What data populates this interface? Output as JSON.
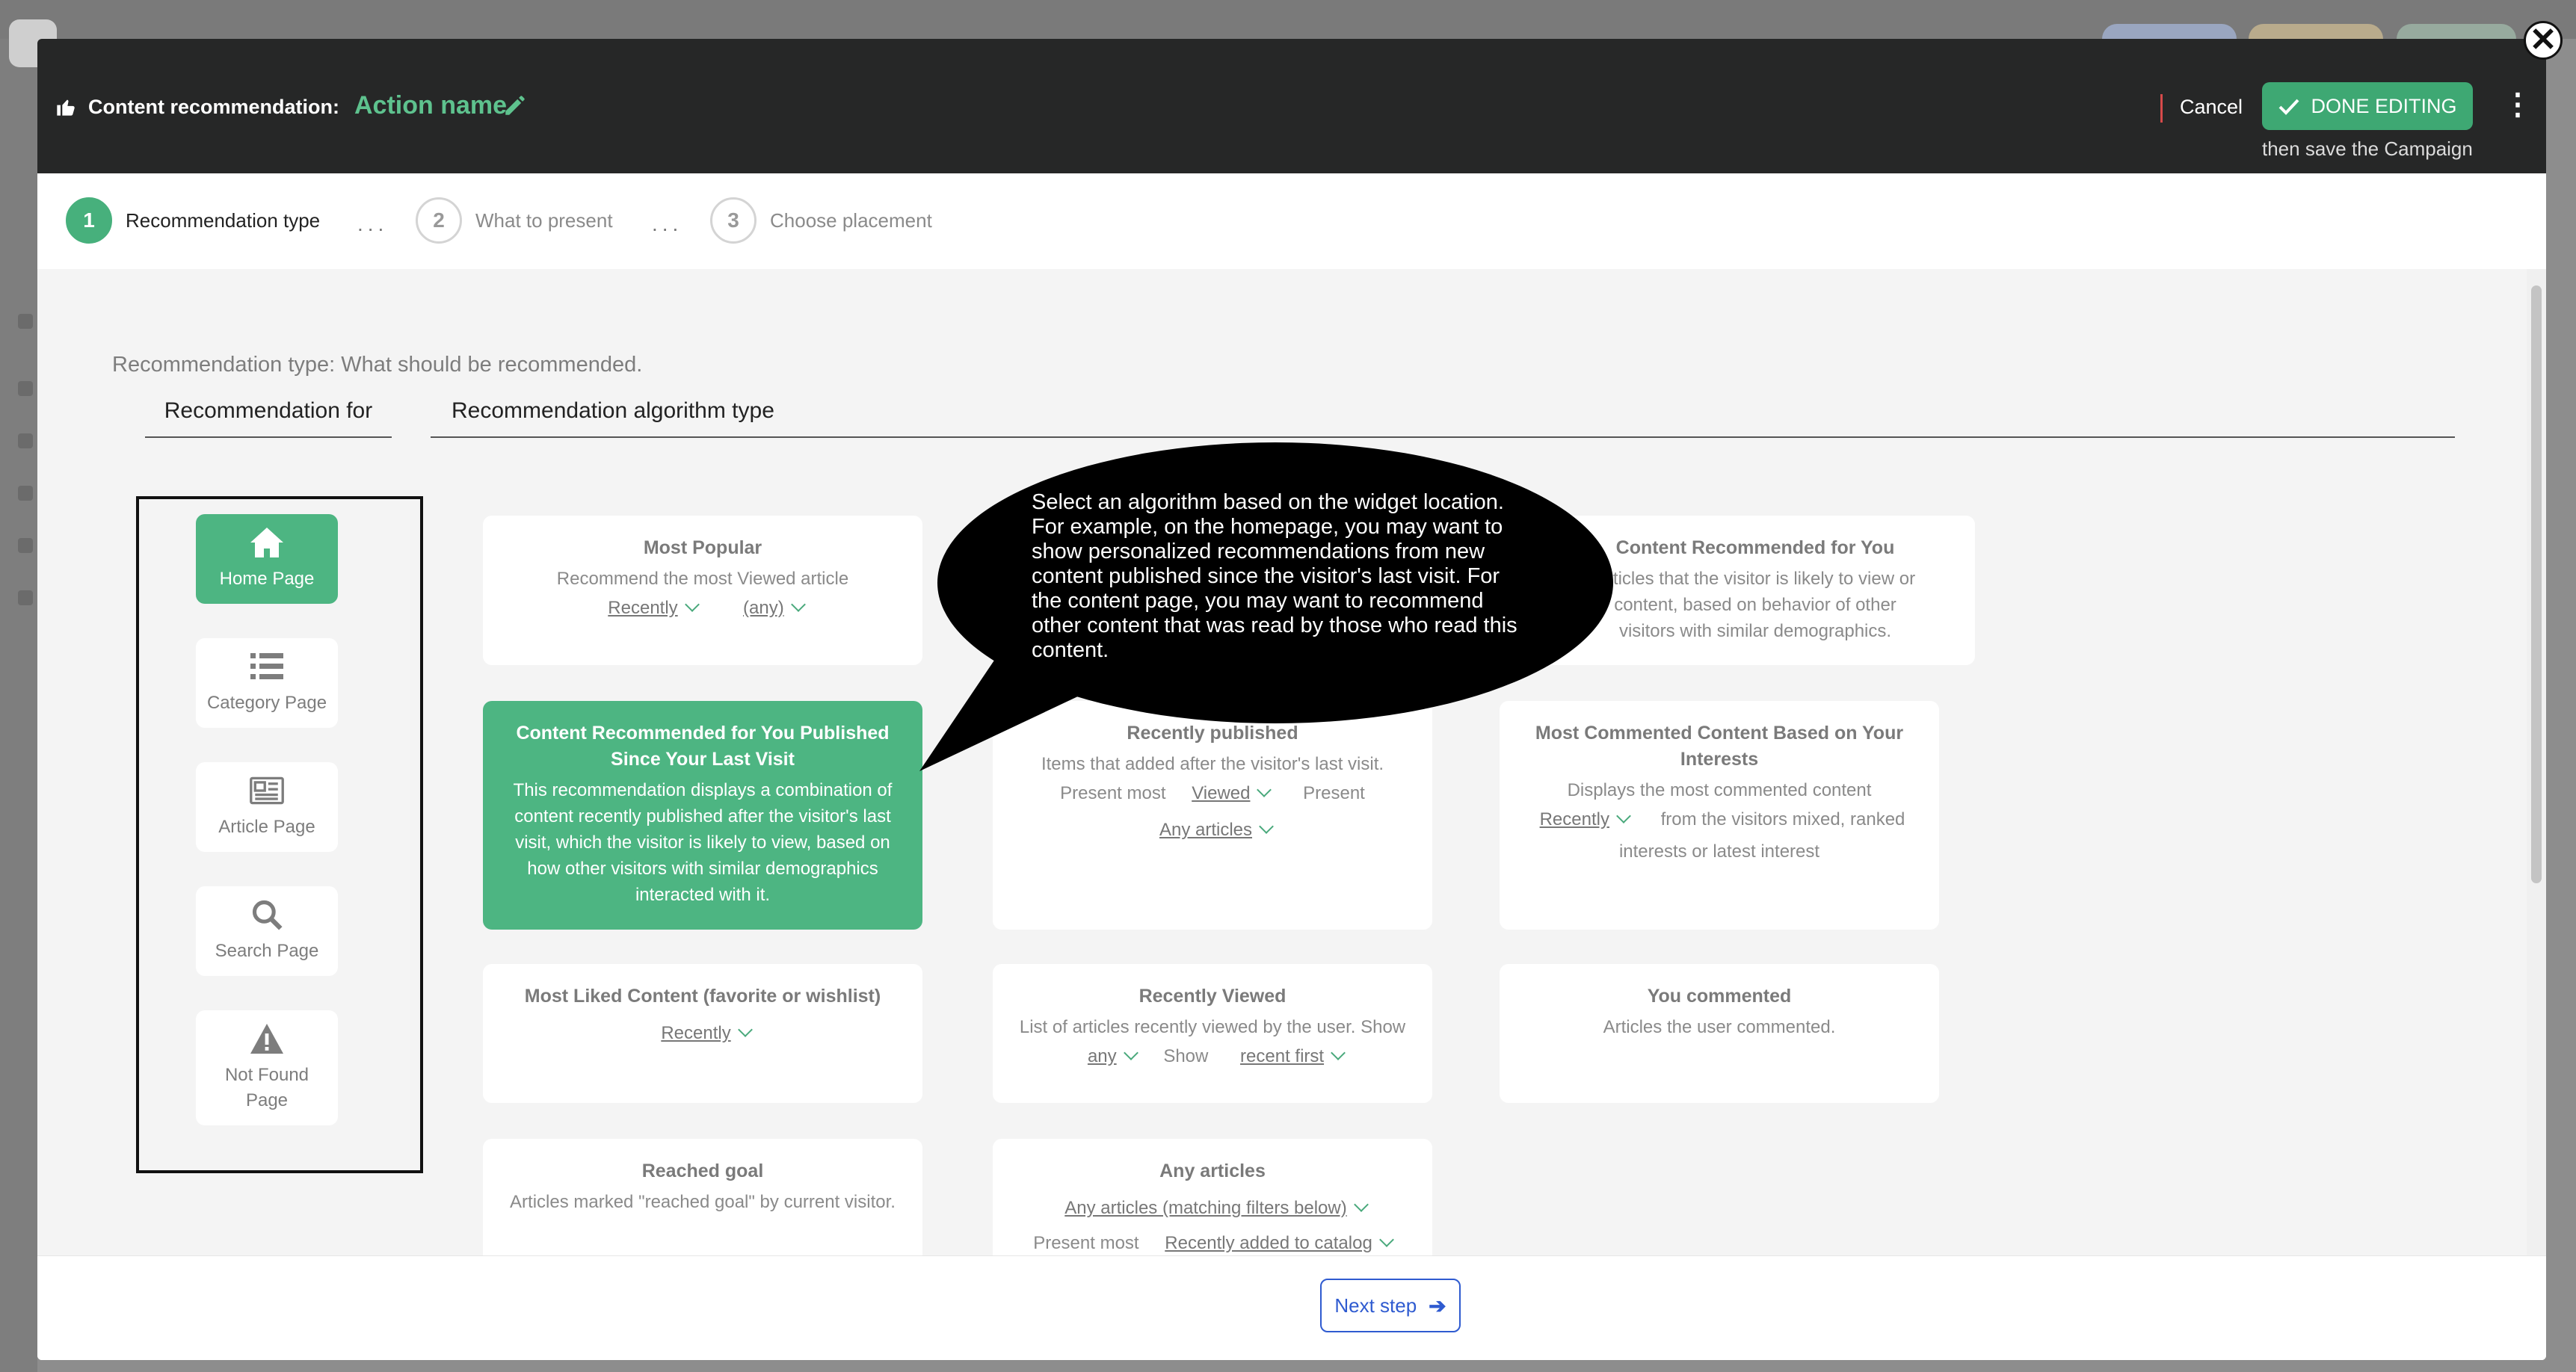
{
  "header": {
    "label": "Content recommendation:",
    "action_name": "Action name",
    "cancel": "Cancel",
    "done": "DONE EDITING",
    "done_sub": "then save the Campaign"
  },
  "close_symbol": "✕",
  "stepper": {
    "steps": [
      {
        "num": "1",
        "label": "Recommendation type"
      },
      {
        "num": "2",
        "label": "What to present"
      },
      {
        "num": "3",
        "label": "Choose placement"
      }
    ],
    "separator": "..."
  },
  "main": {
    "intro": "Recommendation type: What should be recommended.",
    "tab_for": "Recommendation for",
    "tab_algorithm": "Recommendation algorithm type"
  },
  "locations": [
    {
      "label": "Home Page",
      "icon": "home-icon",
      "selected": true
    },
    {
      "label": "Category Page",
      "icon": "list-icon",
      "selected": false
    },
    {
      "label": "Article Page",
      "icon": "newspaper-icon",
      "selected": false
    },
    {
      "label": "Search Page",
      "icon": "search-icon",
      "selected": false
    },
    {
      "label": "Not Found Page",
      "icon": "warning-icon",
      "selected": false
    }
  ],
  "cards": {
    "most_popular": {
      "title": "Most Popular",
      "desc": "Recommend the most Viewed article",
      "opt1": "Recently",
      "opt2": "(any)"
    },
    "content_for_you": {
      "title": "Content Recommended for You",
      "desc": "Articles that the visitor is likely to view or content, based on behavior of other visitors with similar demographics."
    },
    "published_since": {
      "title": "Content Recommended for You Published Since Your Last Visit",
      "desc": "This recommendation displays a combination of content recently published after the visitor's last visit, which the visitor is likely to view, based on how other visitors with similar demographics interacted with it."
    },
    "recently_published": {
      "title": "Recently published",
      "desc": "Items that added after the visitor's last visit.",
      "pre": "Present most",
      "opt1": "Viewed",
      "post": "Present",
      "opt2": "Any articles"
    },
    "most_commented": {
      "title": "Most Commented Content Based on Your Interests",
      "desc": "Displays the most commented content",
      "opt1": "Recently",
      "post": "from the visitors mixed, ranked",
      "tail": "interests or latest interest"
    },
    "most_liked": {
      "title": "Most Liked Content (favorite or wishlist)",
      "opt1": "Recently"
    },
    "recently_viewed": {
      "title": "Recently Viewed",
      "desc": "List of articles recently viewed by the user. Show",
      "opt1": "any",
      "mid": "Show",
      "opt2": "recent first"
    },
    "you_commented": {
      "title": "You commented",
      "desc": "Articles the user commented."
    },
    "reached_goal": {
      "title": "Reached goal",
      "desc": "Articles marked \"reached goal\" by current visitor."
    },
    "any_articles": {
      "title": "Any articles",
      "opt1": "Any articles (matching filters below)",
      "pre": "Present most",
      "opt2": "Recently added to catalog"
    }
  },
  "bubble": {
    "text": "Select an algorithm based on the widget location. For example, on the homepage, you may want to show personalized recommendations from new content published since the visitor's last visit. For the content page, you may want to recommend other content that was read by those who read this content."
  },
  "footer": {
    "next": "Next step"
  },
  "colors": {
    "accent": "#47b07c",
    "header_bg": "#262727",
    "link_blue": "#2f5bd0"
  }
}
